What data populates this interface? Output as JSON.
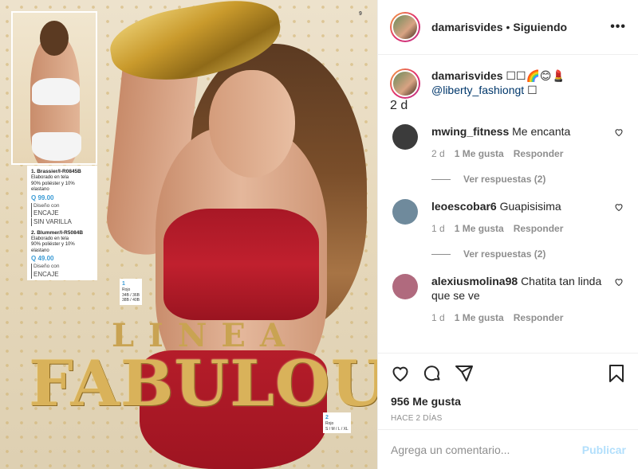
{
  "post": {
    "username": "damarisvides",
    "follow_status": "Siguiendo",
    "more_label": "•••",
    "separator": "•"
  },
  "photo": {
    "page_number": "9",
    "spec": {
      "item1_title": "1. Brassier/I-R0845B",
      "item1_desc1": "Elaborado en tela",
      "item1_desc2": "90% poliéster y 10% elastano",
      "item1_price": "Q 99.00",
      "item1_feature1a": "Diseño con",
      "item1_feature1b": "ENCAJE",
      "item1_feature2": "SIN VARILLA",
      "item2_title": "2. Blummer/I-R5084B",
      "item2_desc1": "Elaborado en tela",
      "item2_desc2": "90% poliéster y 10% elastano",
      "item2_price": "Q 49.00",
      "item2_feature1a": "Diseño con",
      "item2_feature1b": "ENCAJE"
    },
    "tag1": {
      "num": "1",
      "color": "Rojo",
      "sizes1": "34B / 36B",
      "sizes2": "38B / 40B"
    },
    "tag2": {
      "num": "2",
      "color": "Rojo",
      "sizes1": "S / M / L / XL"
    },
    "headline_small": "LINEA",
    "headline_big": "FABULOUS"
  },
  "caption": {
    "username": "damarisvides",
    "text": "☐☐🌈😊💄",
    "mention": "@liberty_fashiongt",
    "suffix": "☐",
    "age": "2 d"
  },
  "comments": [
    {
      "username": "mwing_fitness",
      "text": "Me encanta",
      "age": "2 d",
      "likes": "1 Me gusta",
      "reply": "Responder",
      "replies": "Ver respuestas (2)",
      "avatar_color": "#3b3b3b"
    },
    {
      "username": "leoescobar6",
      "text": "Guapisisima",
      "age": "1 d",
      "likes": "1 Me gusta",
      "reply": "Responder",
      "replies": "Ver respuestas (2)",
      "avatar_color": "#6f8a9c"
    },
    {
      "username": "alexiusmolina98",
      "text": "Chatita tan linda que se ve",
      "age": "1 d",
      "likes": "1 Me gusta",
      "reply": "Responder",
      "avatar_color": "#b06a7e"
    }
  ],
  "footer": {
    "likes": "956 Me gusta",
    "date": "HACE 2 DÍAS",
    "comment_placeholder": "Agrega un comentario...",
    "publish": "Publicar"
  },
  "icons": [
    "more-options-icon",
    "heart-icon",
    "comment-icon",
    "share-icon",
    "bookmark-icon"
  ],
  "colors": {
    "link": "#00376b",
    "muted": "#8e8e8e",
    "publish_disabled": "#b2dffc",
    "price": "#3a9bd5"
  }
}
